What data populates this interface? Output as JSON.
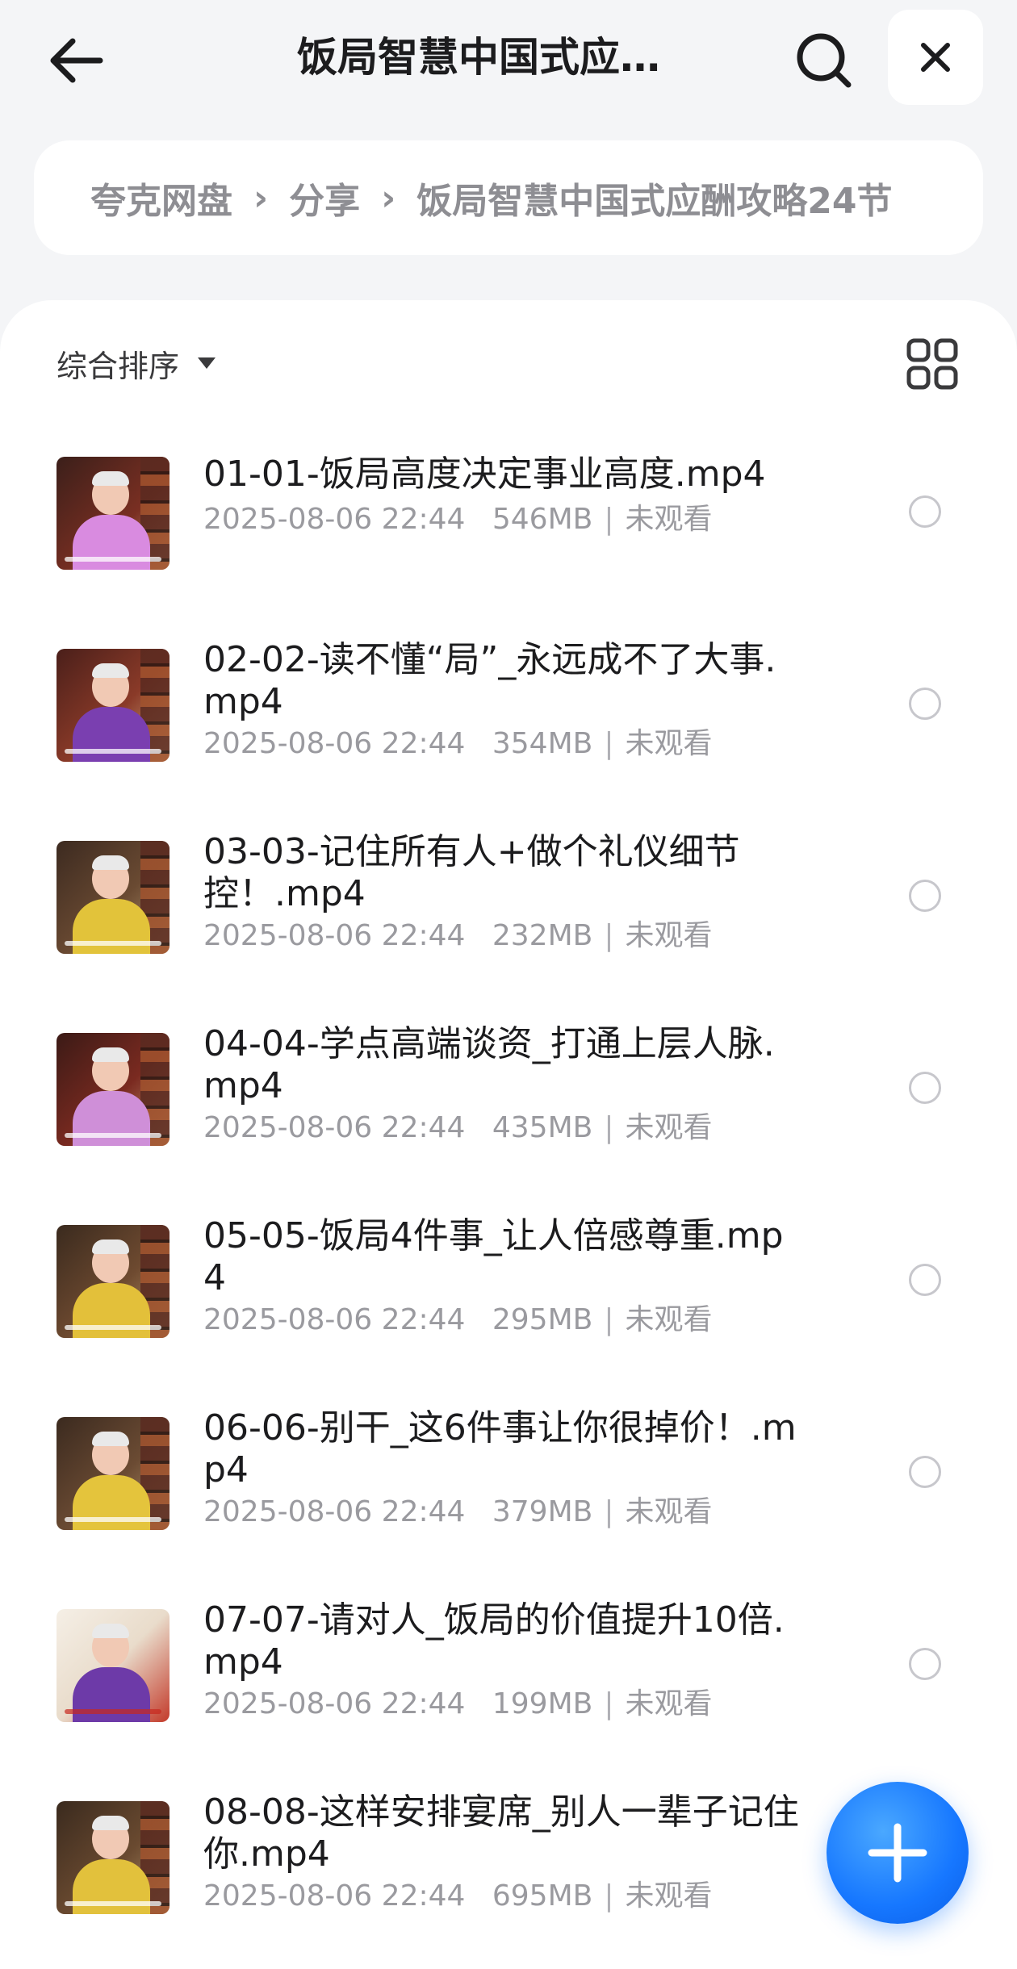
{
  "header": {
    "title": "饭局智慧中国式应…",
    "back_icon": "arrow-left-icon",
    "search_icon": "search-icon",
    "close_icon": "close-icon"
  },
  "breadcrumb": {
    "items": [
      "夸克网盘",
      "分享",
      "饭局智慧中国式应酬攻略24节"
    ],
    "separator": "›"
  },
  "toolbar": {
    "sort_label": "综合排序",
    "sort_icon": "caret-down-icon",
    "view_icon": "grid-view-icon"
  },
  "files": [
    {
      "name": "01-01-饭局高度决定事业高度.mp4",
      "date": "2025-08-06 22:44",
      "size": "546MB",
      "status": "未观看"
    },
    {
      "name": "02-02-读不懂“局”_永远成不了大事.mp4",
      "date": "2025-08-06 22:44",
      "size": "354MB",
      "status": "未观看"
    },
    {
      "name": "03-03-记住所有人+做个礼仪细节控！.mp4",
      "date": "2025-08-06 22:44",
      "size": "232MB",
      "status": "未观看"
    },
    {
      "name": "04-04-学点高端谈资_打通上层人脉.mp4",
      "date": "2025-08-06 22:44",
      "size": "435MB",
      "status": "未观看"
    },
    {
      "name": "05-05-饭局4件事_让人倍感尊重.mp4",
      "date": "2025-08-06 22:44",
      "size": "295MB",
      "status": "未观看"
    },
    {
      "name": "06-06-别干_这6件事让你很掉价！.mp4",
      "date": "2025-08-06 22:44",
      "size": "379MB",
      "status": "未观看"
    },
    {
      "name": "07-07-请对人_饭局的价值提升10倍.mp4",
      "date": "2025-08-06 22:44",
      "size": "199MB",
      "status": "未观看"
    },
    {
      "name": "08-08-这样安排宴席_别人一辈子记住你.mp4",
      "date": "2025-08-06 22:44",
      "size": "695MB",
      "status": "未观看"
    }
  ],
  "fab": {
    "icon": "plus-icon"
  },
  "colors": {
    "accent": "#1677ff",
    "background": "#f4f5f7",
    "card": "#ffffff",
    "secondary_text": "#9a9a9f"
  }
}
